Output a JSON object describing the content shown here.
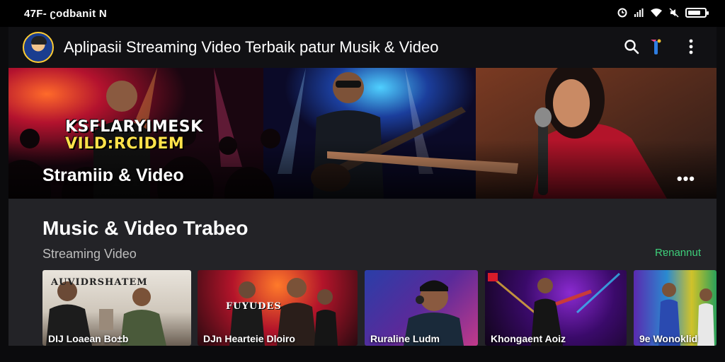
{
  "status_bar": {
    "left_text": "47F- ʗodbanit  N",
    "icons": [
      "alarm-icon",
      "signal-icon",
      "wifi-icon",
      "mute-icon",
      "battery-icon"
    ],
    "battery_level": 0.75
  },
  "app_bar": {
    "title": "Aplipasii Streaming Video Terbaik patur Musik & Video",
    "actions": [
      "search-icon",
      "cast-icon",
      "more-vert-icon"
    ]
  },
  "hero": {
    "overlay_line1": "KSFLARYIMESK",
    "overlay_line2": "VILD:RCIDEM",
    "caption": "Stramiiɒ & Video",
    "more_label": "•••"
  },
  "section": {
    "title": "Music & Video Trabeo",
    "subtitle": "Streaming Video",
    "link": "Rɐnannut"
  },
  "cards": [
    {
      "heading": "AUVIDRSHATEM",
      "label": "DIJ Loaean   Bo±b"
    },
    {
      "heading": "FUYUDES",
      "label": "DJn Hearteie   Dloiro"
    },
    {
      "heading": "",
      "label": "Ruraline   Ludm"
    },
    {
      "heading": "",
      "label": "Khongaent   Aoiz"
    },
    {
      "heading": "",
      "label": "9e   Wonoklid"
    }
  ],
  "colors": {
    "background": "#0b0b0d",
    "app_bar": "#111114",
    "panel": "#232327",
    "accent_link": "#3ecf7a",
    "overlay_yellow": "#ffe24a"
  }
}
